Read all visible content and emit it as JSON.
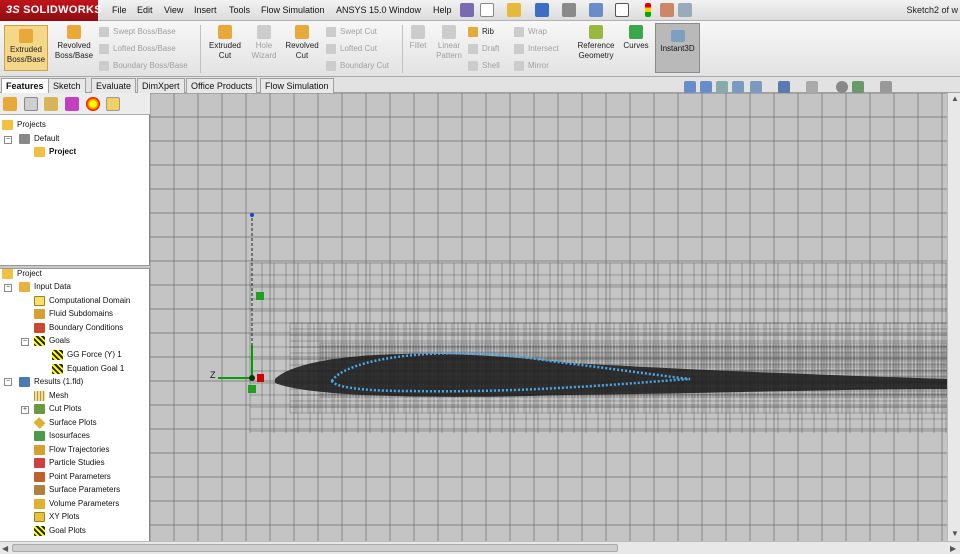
{
  "app": {
    "logo": "SOLIDWORKS",
    "logo_prefix": "3S",
    "title": "Sketch2 of w"
  },
  "menu": [
    "File",
    "Edit",
    "View",
    "Insert",
    "Tools",
    "Flow Simulation",
    "ANSYS 15.0",
    "Window",
    "Help"
  ],
  "features": {
    "extruded_boss": [
      "Extruded",
      "Boss/Base"
    ],
    "revolved_boss": [
      "Revolved",
      "Boss/Base"
    ],
    "swept_boss": "Swept Boss/Base",
    "lofted_boss": "Lofted Boss/Base",
    "boundary_boss": "Boundary Boss/Base",
    "extruded_cut": [
      "Extruded",
      "Cut"
    ],
    "hole_wizard": [
      "Hole",
      "Wizard"
    ],
    "revolved_cut": [
      "Revolved",
      "Cut"
    ],
    "swept_cut": "Swept Cut",
    "lofted_cut": "Lofted Cut",
    "boundary_cut": "Boundary Cut",
    "fillet": "Fillet",
    "linear_pattern": [
      "Linear",
      "Pattern"
    ],
    "rib": "Rib",
    "draft": "Draft",
    "shell": "Shell",
    "wrap": "Wrap",
    "intersect": "Intersect",
    "mirror": "Mirror",
    "reference_geometry": [
      "Reference",
      "Geometry"
    ],
    "curves": "Curves",
    "instant3d": "Instant3D"
  },
  "tabs": [
    "Features",
    "Sketch",
    "Evaluate",
    "DimXpert",
    "Office Products",
    "Flow Simulation"
  ],
  "projects_tree": {
    "root": "Projects",
    "config": "Default",
    "project": "Project"
  },
  "analysis_tree": {
    "root": "Project",
    "input_data": "Input Data",
    "input_items": [
      "Computational Domain",
      "Fluid Subdomains",
      "Boundary Conditions"
    ],
    "goals": "Goals",
    "goal_items": [
      "GG Force (Y) 1",
      "Equation Goal 1"
    ],
    "results": "Results (1.fld)",
    "result_items": [
      "Mesh",
      "Cut Plots",
      "Surface Plots",
      "Isosurfaces",
      "Flow Trajectories",
      "Particle Studies",
      "Point Parameters",
      "Surface Parameters",
      "Volume Parameters",
      "XY Plots",
      "Goal Plots"
    ]
  },
  "axis_labels": {
    "z": "Z"
  },
  "colors": {
    "accent": "#c0141a",
    "viewport": "#c4c4c4",
    "airfoil_outline": "#4aa8e8",
    "axis_y": "#00a000",
    "axis_z": "#00a000",
    "origin": "#d00000"
  }
}
